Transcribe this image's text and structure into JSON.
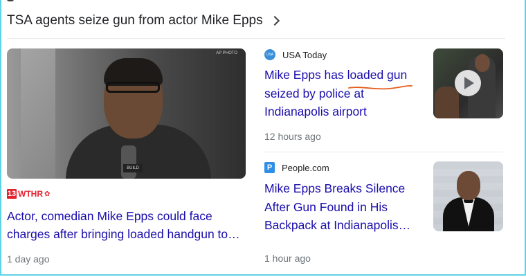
{
  "headline": {
    "text": "TSA agents seize gun from actor Mike Epps"
  },
  "left_card": {
    "source_name": "WTHR",
    "source_badge": "13",
    "image_watermark": "AP PHOTO",
    "image_mic_tag": "BUILD",
    "title": "Actor, comedian Mike Epps could face charges after bringing loaded handgun to…",
    "time": "1 day ago"
  },
  "right_cards": [
    {
      "source_name": "USA Today",
      "title": "Mike Epps has loaded gun seized by police at Indianapolis airport",
      "time": "12 hours ago",
      "thumbnail": "video-thumbnail",
      "has_play": true
    },
    {
      "source_name": "People.com",
      "source_icon_letter": "P",
      "title": "Mike Epps Breaks Silence After Gun Found in His Backpack at Indianapolis…",
      "time": "1 hour ago",
      "thumbnail": "photo-thumbnail"
    }
  ],
  "colors": {
    "link": "#1a0dab",
    "meta": "#70757a",
    "frame": "#5fd2e6",
    "annotation": "#e65a1a",
    "wthr_red": "#e3222e"
  }
}
